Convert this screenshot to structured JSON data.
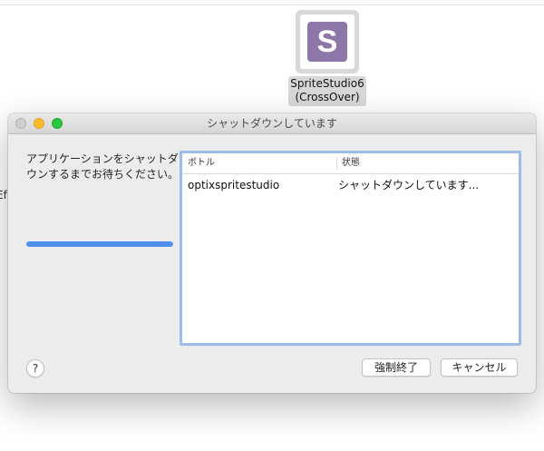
{
  "desktop": {
    "fragment_text": "Ef",
    "app_icon": {
      "letter": "S",
      "label_line1": "SpriteStudio6",
      "label_line2": "(CrossOver)"
    }
  },
  "dialog": {
    "title": "シャットダウンしています",
    "message": "アプリケーションをシャットダウンするまでお待ちください。",
    "progress_fraction": 1.0,
    "table": {
      "headers": [
        "ボトル",
        "状態"
      ],
      "rows": [
        [
          "optixspritestudio",
          "シャットダウンしています..."
        ]
      ]
    },
    "help_label": "?",
    "force_quit_label": "強制終了",
    "cancel_label": "キャンセル"
  },
  "colors": {
    "accent": "#4f8ff0",
    "table_focus_ring": "#9ebcea",
    "minimize": "#febc2e",
    "zoom": "#28c840",
    "icon_purple": "#8c77a8"
  }
}
